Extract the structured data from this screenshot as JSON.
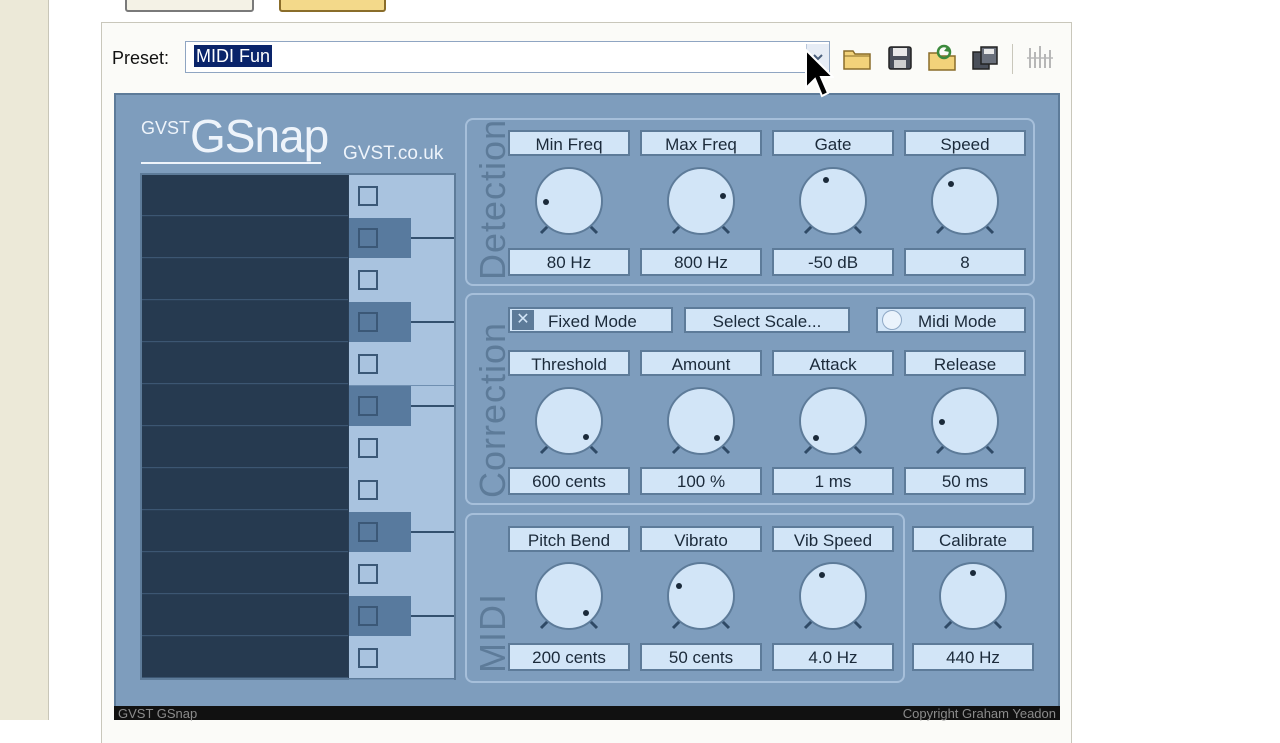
{
  "preset": {
    "label": "Preset:",
    "value": "MIDI Fun"
  },
  "toolbar_icons": [
    "open-folder-icon",
    "save-icon",
    "load-icon",
    "copy-icon",
    "bars-icon"
  ],
  "plugin": {
    "brand_small": "GVST",
    "brand_large": "GSnap",
    "url": "GVST.co.uk",
    "footer_left": "GVST GSnap",
    "footer_right": "Copyright Graham Yeadon",
    "colors": {
      "panel": "#7e9dbd",
      "control": "#d2e5f7",
      "keyboard": "#263a50"
    }
  },
  "detection": {
    "title": "Detection",
    "controls": [
      {
        "label": "Min Freq",
        "value": "80 Hz"
      },
      {
        "label": "Max Freq",
        "value": "800 Hz"
      },
      {
        "label": "Gate",
        "value": "-50 dB"
      },
      {
        "label": "Speed",
        "value": "8"
      }
    ]
  },
  "correction": {
    "title": "Correction",
    "fixed_mode": "Fixed Mode",
    "select_scale": "Select Scale...",
    "midi_mode": "Midi Mode",
    "controls": [
      {
        "label": "Threshold",
        "value": "600 cents"
      },
      {
        "label": "Amount",
        "value": "100 %"
      },
      {
        "label": "Attack",
        "value": "1 ms"
      },
      {
        "label": "Release",
        "value": "50 ms"
      }
    ]
  },
  "midi": {
    "title": "MIDI",
    "controls": [
      {
        "label": "Pitch Bend",
        "value": "200 cents"
      },
      {
        "label": "Vibrato",
        "value": "50 cents"
      },
      {
        "label": "Vib Speed",
        "value": "4.0 Hz"
      }
    ],
    "calibrate": {
      "label": "Calibrate",
      "value": "440 Hz"
    }
  }
}
